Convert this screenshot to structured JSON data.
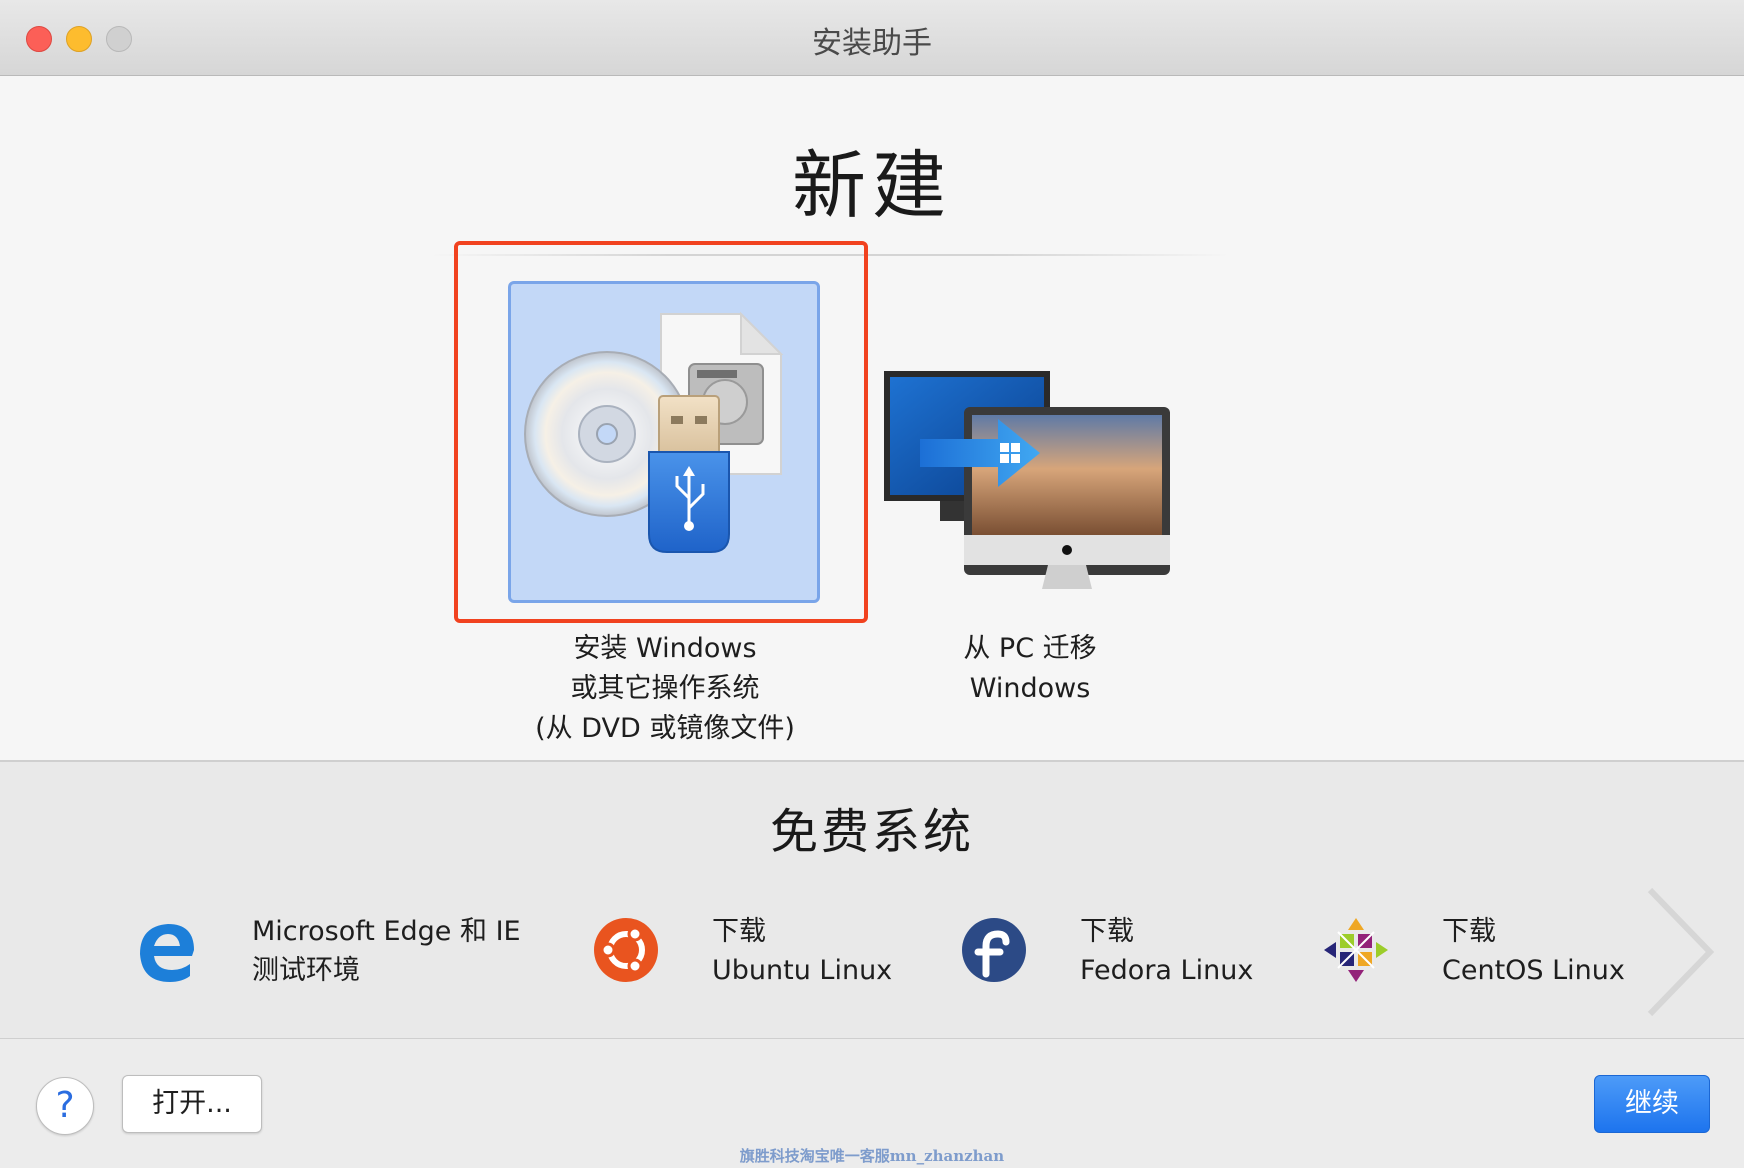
{
  "window": {
    "title": "安装助手"
  },
  "new_section": {
    "title": "新建",
    "options": [
      {
        "label_lines": [
          "安装 Windows",
          "或其它操作系统",
          "(从 DVD 或镜像文件)"
        ],
        "selected": true
      },
      {
        "label_lines": [
          "从 PC 迁移",
          "Windows"
        ],
        "selected": false
      }
    ]
  },
  "free_section": {
    "title": "免费系统",
    "items": [
      {
        "line1": "Microsoft Edge 和 IE",
        "line2": "测试环境",
        "icon": "edge-icon"
      },
      {
        "line1": "下载",
        "line2": "Ubuntu Linux",
        "icon": "ubuntu-icon"
      },
      {
        "line1": "下载",
        "line2": "Fedora Linux",
        "icon": "fedora-icon"
      },
      {
        "line1": "下载",
        "line2": "CentOS Linux",
        "icon": "centos-icon"
      }
    ]
  },
  "bottom": {
    "help_label": "?",
    "open_label": "打开...",
    "continue_label": "继续"
  },
  "watermark": "旗胜科技淘宝唯一客服mn_zhanzhan",
  "colors": {
    "accent": "#1d74ee",
    "selection_frame": "#f1421f",
    "tile_selected": "#c3d8f7"
  }
}
